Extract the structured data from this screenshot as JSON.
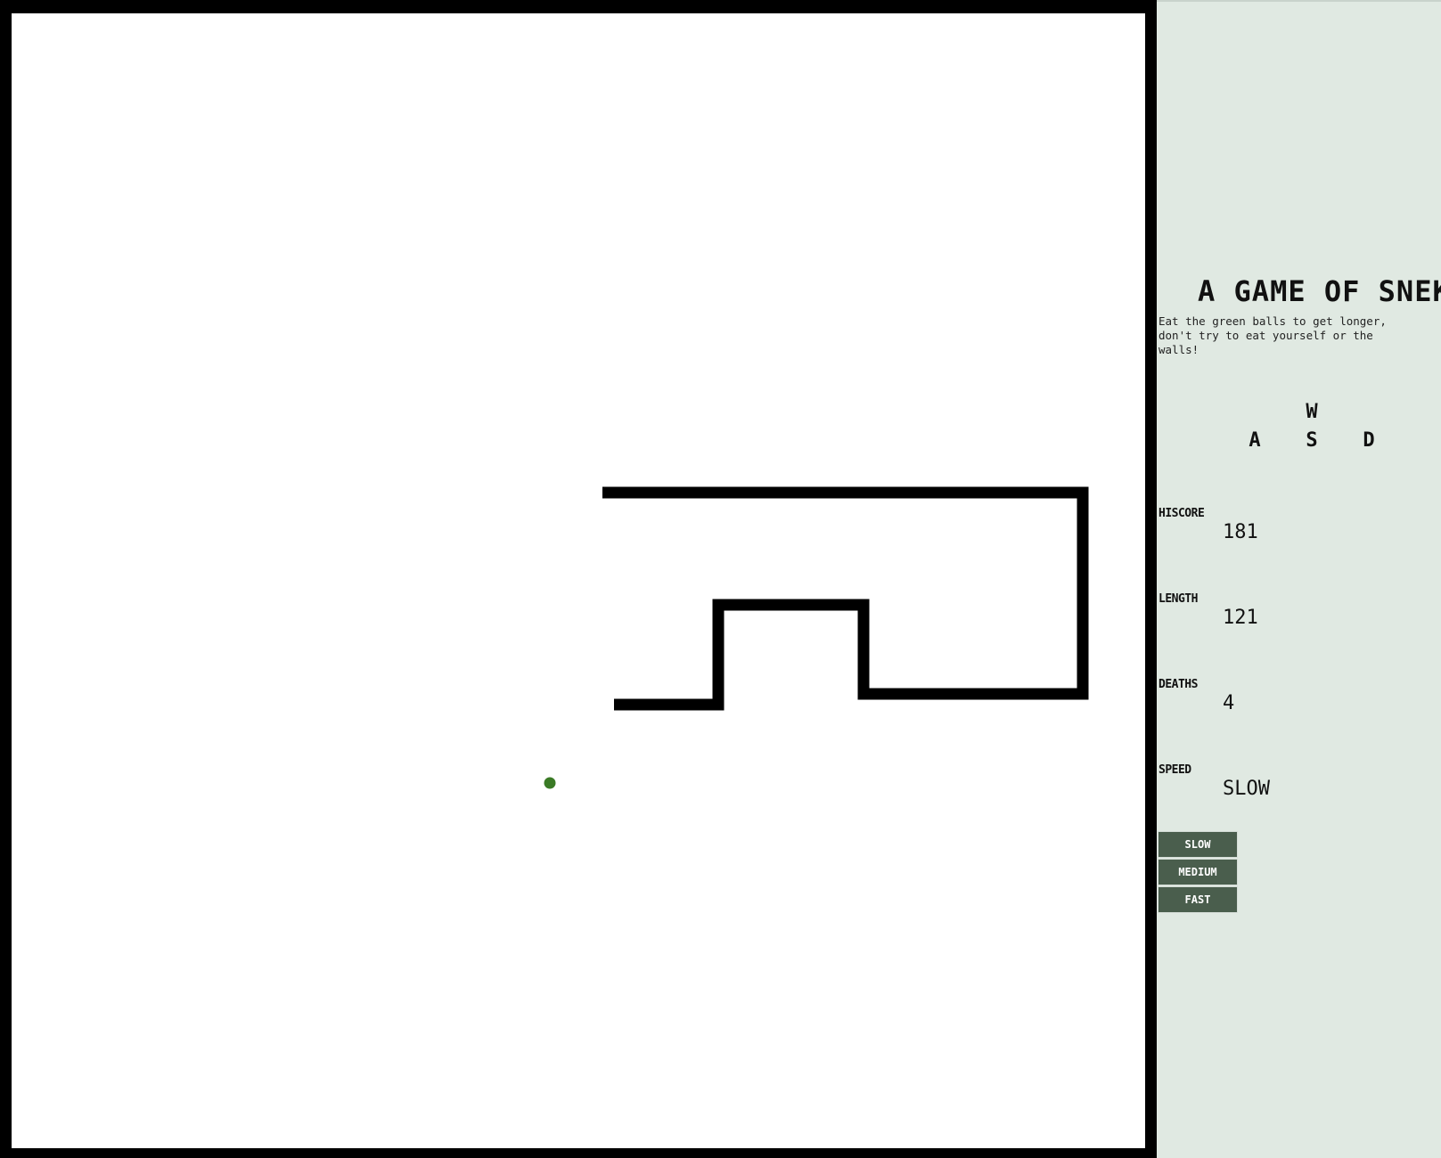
{
  "game": {
    "title": "A GAME OF SNEK",
    "instructions": "Eat the green balls to get longer, don't try to eat yourself or the walls!"
  },
  "controls": {
    "up_key": "W",
    "left_key": "A",
    "down_key": "S",
    "right_key": "D"
  },
  "stats": {
    "hiscore_label": "HISCORE",
    "hiscore_value": "181",
    "length_label": "LENGTH",
    "length_value": "121",
    "deaths_label": "DEATHS",
    "deaths_value": "4",
    "speed_label": "SPEED",
    "speed_value": "SLOW"
  },
  "speed_buttons": {
    "slow": "SLOW",
    "medium": "MEDIUM",
    "fast": "FAST"
  },
  "colors": {
    "snake": "#000000",
    "food": "#3a7a25",
    "board_background": "#ffffff",
    "wall": "#000000",
    "sidebar_background": "#e0e9e2",
    "button_background": "#4a5e4d"
  }
}
